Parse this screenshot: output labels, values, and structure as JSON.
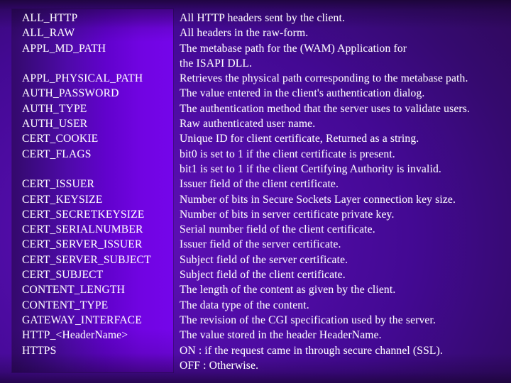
{
  "slide": {
    "background_color_dark": "#2a0749",
    "background_color_mid": "#4b0a96",
    "panel_color_left": "#34096c",
    "panel_color_right": "#7505ea",
    "text_color": "#fdfbff"
  },
  "table": {
    "rows": [
      {
        "name": "ALL_HTTP",
        "description": "All HTTP headers sent by the client."
      },
      {
        "name": "ALL_RAW",
        "description": "All headers in the raw-form."
      },
      {
        "name": "APPL_MD_PATH",
        "description": "The metabase path for the (WAM) Application for"
      },
      {
        "name": "",
        "description": "the ISAPI DLL."
      },
      {
        "name": "APPL_PHYSICAL_PATH",
        "description": "Retrieves the physical path corresponding to the metabase path."
      },
      {
        "name": "AUTH_PASSWORD",
        "description": "The value entered in the client's authentication dialog."
      },
      {
        "name": "AUTH_TYPE",
        "description": "The authentication method that the server uses to validate users."
      },
      {
        "name": "AUTH_USER",
        "description": "Raw authenticated user name."
      },
      {
        "name": "CERT_COOKIE",
        "description": "Unique ID for client certificate, Returned as a string."
      },
      {
        "name": "CERT_FLAGS",
        "description": "bit0 is set to 1 if the client certificate is present."
      },
      {
        "name": "",
        "description": "bit1 is set to 1 if the client Certifying Authority is invalid."
      },
      {
        "name": "CERT_ISSUER",
        "description": "Issuer field of the client certificate."
      },
      {
        "name": "CERT_KEYSIZE",
        "description": "Number of bits in Secure Sockets Layer connection key size."
      },
      {
        "name": "CERT_SECRETKEYSIZE",
        "description": "Number of bits in server certificate private key."
      },
      {
        "name": "CERT_SERIALNUMBER",
        "description": "Serial number field of the client certificate."
      },
      {
        "name": "CERT_SERVER_ISSUER",
        "description": "Issuer field of the server certificate."
      },
      {
        "name": "CERT_SERVER_SUBJECT",
        "description": "Subject field of the server certificate."
      },
      {
        "name": "CERT_SUBJECT",
        "description": "Subject field of the client certificate."
      },
      {
        "name": "CONTENT_LENGTH",
        "description": "The length of the content as given by the client."
      },
      {
        "name": "CONTENT_TYPE",
        "description": "The data type of the content."
      },
      {
        "name": "GATEWAY_INTERFACE",
        "description": "The revision of the CGI specification used by the server."
      },
      {
        "name": "HTTP_<HeaderName>",
        "description": "The value stored in the header HeaderName."
      },
      {
        "name": "HTTPS",
        "description": "ON : if the request came in through secure channel (SSL)."
      },
      {
        "name": "",
        "description": "OFF : Otherwise."
      }
    ]
  }
}
